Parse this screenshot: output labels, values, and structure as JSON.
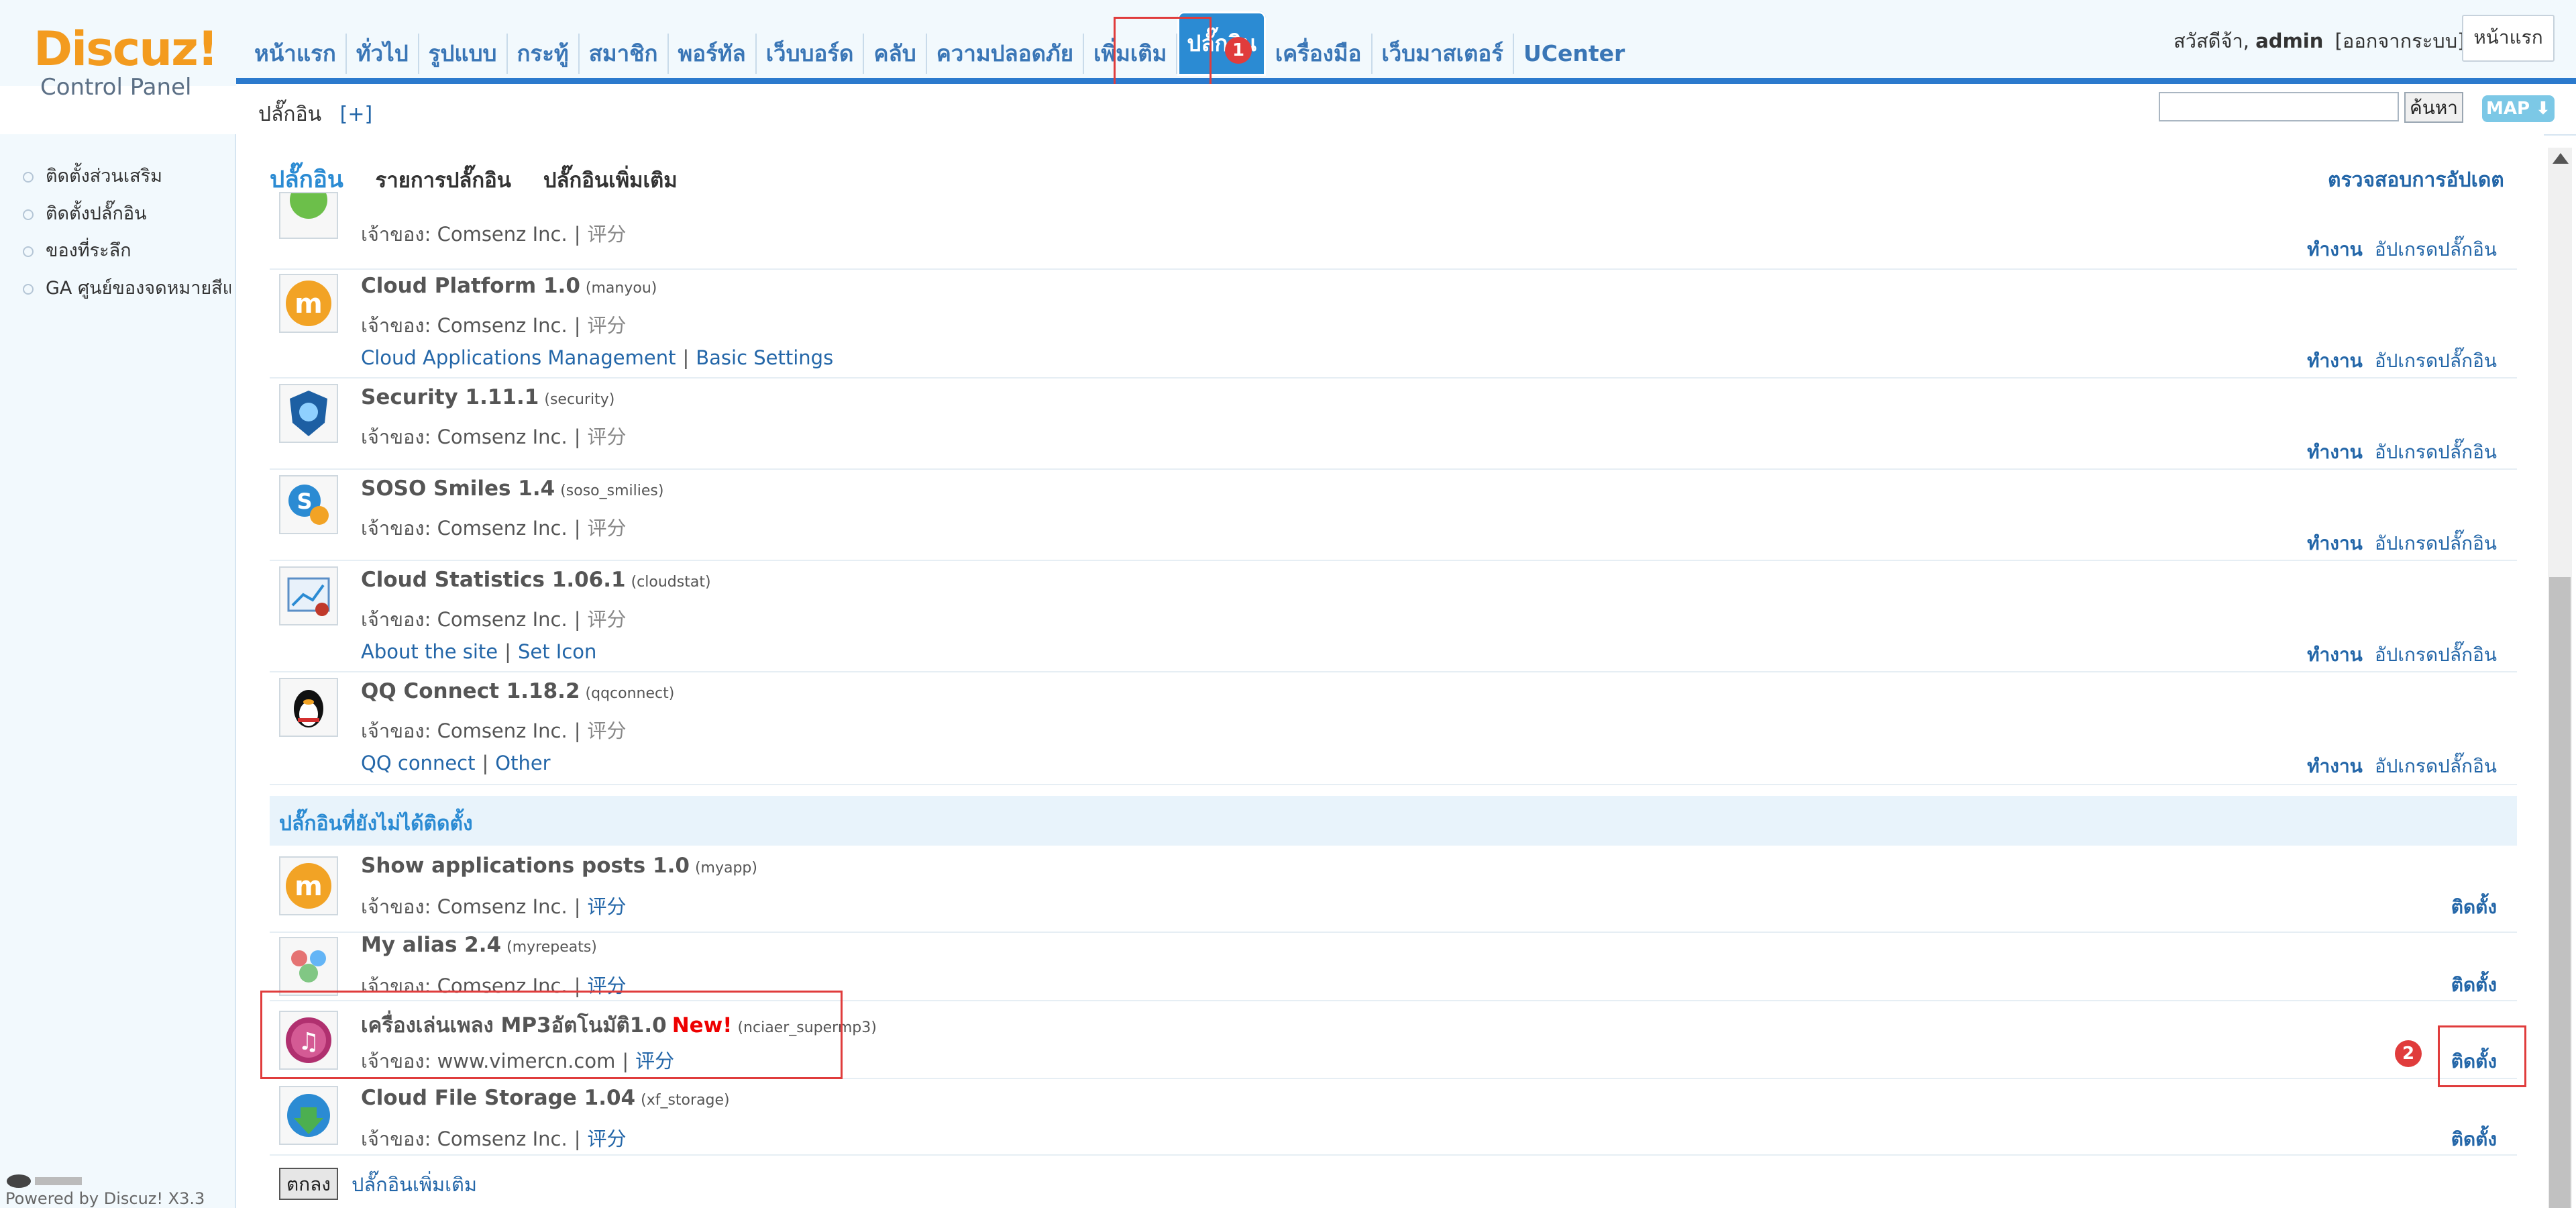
{
  "logo": {
    "brand": "Discuz!",
    "subtitle": "Control Panel"
  },
  "nav": {
    "items": [
      "หน้าแรก",
      "ทั่วไป",
      "รูปแบบ",
      "กระทู้",
      "สมาชิก",
      "พอร์ทัล",
      "เว็บบอร์ด",
      "คลับ",
      "ความปลอดภัย",
      "เพิ่มเติม",
      "ปลั๊กอิน",
      "เครื่องมือ",
      "เว็บมาสเตอร์",
      "UCenter"
    ],
    "active_index": 10
  },
  "header": {
    "greeting": "สวัสดีจ้า,",
    "user": "admin",
    "logout": "[ออกจากระบบ]",
    "home_button": "หน้าแรก"
  },
  "subheader": {
    "title": "ปลั๊กอิน",
    "add": "[+]",
    "search_button": "ค้นหา",
    "map_button": "MAP ⬇"
  },
  "sidebar": {
    "items": [
      "ติดตั้งส่วนเสริม",
      "ติดตั้งปลั๊กอิน",
      "ของที่ระลึก",
      "GA ศูนย์ของจดหมายสีแ"
    ]
  },
  "footer": {
    "text": "Powered by Discuz! X3.3"
  },
  "tabs": {
    "current": "ปลั๊กอิน",
    "list": "รายการปลั๊กอิน",
    "more": "ปลั๊กอินเพิ่มเติม",
    "check_update": "ตรวจสอบการอัปเดต"
  },
  "installed": [
    {
      "name": "",
      "id": "",
      "owner": "เจ้าของ: Comsenz Inc.",
      "rate": "评分",
      "links": [],
      "action": "ทำงาน",
      "upgrade": "อัปเกรดปลั๊กอิน"
    },
    {
      "name": "Cloud Platform 1.0",
      "id": "(manyou)",
      "owner": "เจ้าของ: Comsenz Inc.",
      "rate": "评分",
      "links": [
        "Cloud Applications Management",
        "Basic Settings"
      ],
      "action": "ทำงาน",
      "upgrade": "อัปเกรดปลั๊กอิน"
    },
    {
      "name": "Security 1.11.1",
      "id": "(security)",
      "owner": "เจ้าของ: Comsenz Inc.",
      "rate": "评分",
      "links": [],
      "action": "ทำงาน",
      "upgrade": "อัปเกรดปลั๊กอิน"
    },
    {
      "name": "SOSO Smiles 1.4",
      "id": "(soso_smilies)",
      "owner": "เจ้าของ: Comsenz Inc.",
      "rate": "评分",
      "links": [],
      "action": "ทำงาน",
      "upgrade": "อัปเกรดปลั๊กอิน"
    },
    {
      "name": "Cloud Statistics 1.06.1",
      "id": "(cloudstat)",
      "owner": "เจ้าของ: Comsenz Inc.",
      "rate": "评分",
      "links": [
        "About the site",
        "Set Icon"
      ],
      "action": "ทำงาน",
      "upgrade": "อัปเกรดปลั๊กอิน"
    },
    {
      "name": "QQ Connect 1.18.2",
      "id": "(qqconnect)",
      "owner": "เจ้าของ: Comsenz Inc.",
      "rate": "评分",
      "links": [
        "QQ connect",
        "Other"
      ],
      "action": "ทำงาน",
      "upgrade": "อัปเกรดปลั๊กอิน"
    }
  ],
  "not_installed_header": "ปลั๊กอินที่ยังไม่ได้ติดตั้ง",
  "not_installed": [
    {
      "name": "Show applications posts 1.0",
      "id": "(myapp)",
      "owner": "เจ้าของ: Comsenz Inc.",
      "rate": "评分",
      "install": "ติดตั้ง"
    },
    {
      "name": "My alias 2.4",
      "id": "(myrepeats)",
      "owner": "เจ้าของ: Comsenz Inc.",
      "rate": "评分",
      "install": "ติดตั้ง"
    },
    {
      "name": "เครื่องเล่นเพลง MP3อัตโนมัติ1.0",
      "new": "New!",
      "id": "(nciaer_supermp3)",
      "owner": "เจ้าของ: www.vimercn.com",
      "rate": "评分",
      "install": "ติดตั้ง"
    },
    {
      "name": "Cloud File Storage 1.04",
      "id": "(xf_storage)",
      "owner": "เจ้าของ: Comsenz Inc.",
      "rate": "评分",
      "install": "ติดตั้ง"
    }
  ],
  "bottom": {
    "ok": "ตกลง",
    "more": "ปลั๊กอินเพิ่มเติม"
  },
  "annotations": {
    "badge1": "1",
    "badge2": "2"
  },
  "colors": {
    "accent": "#2b8bd3",
    "link": "#2366a8",
    "highlight": "#e03c3c",
    "logo": "#f39b1f"
  }
}
